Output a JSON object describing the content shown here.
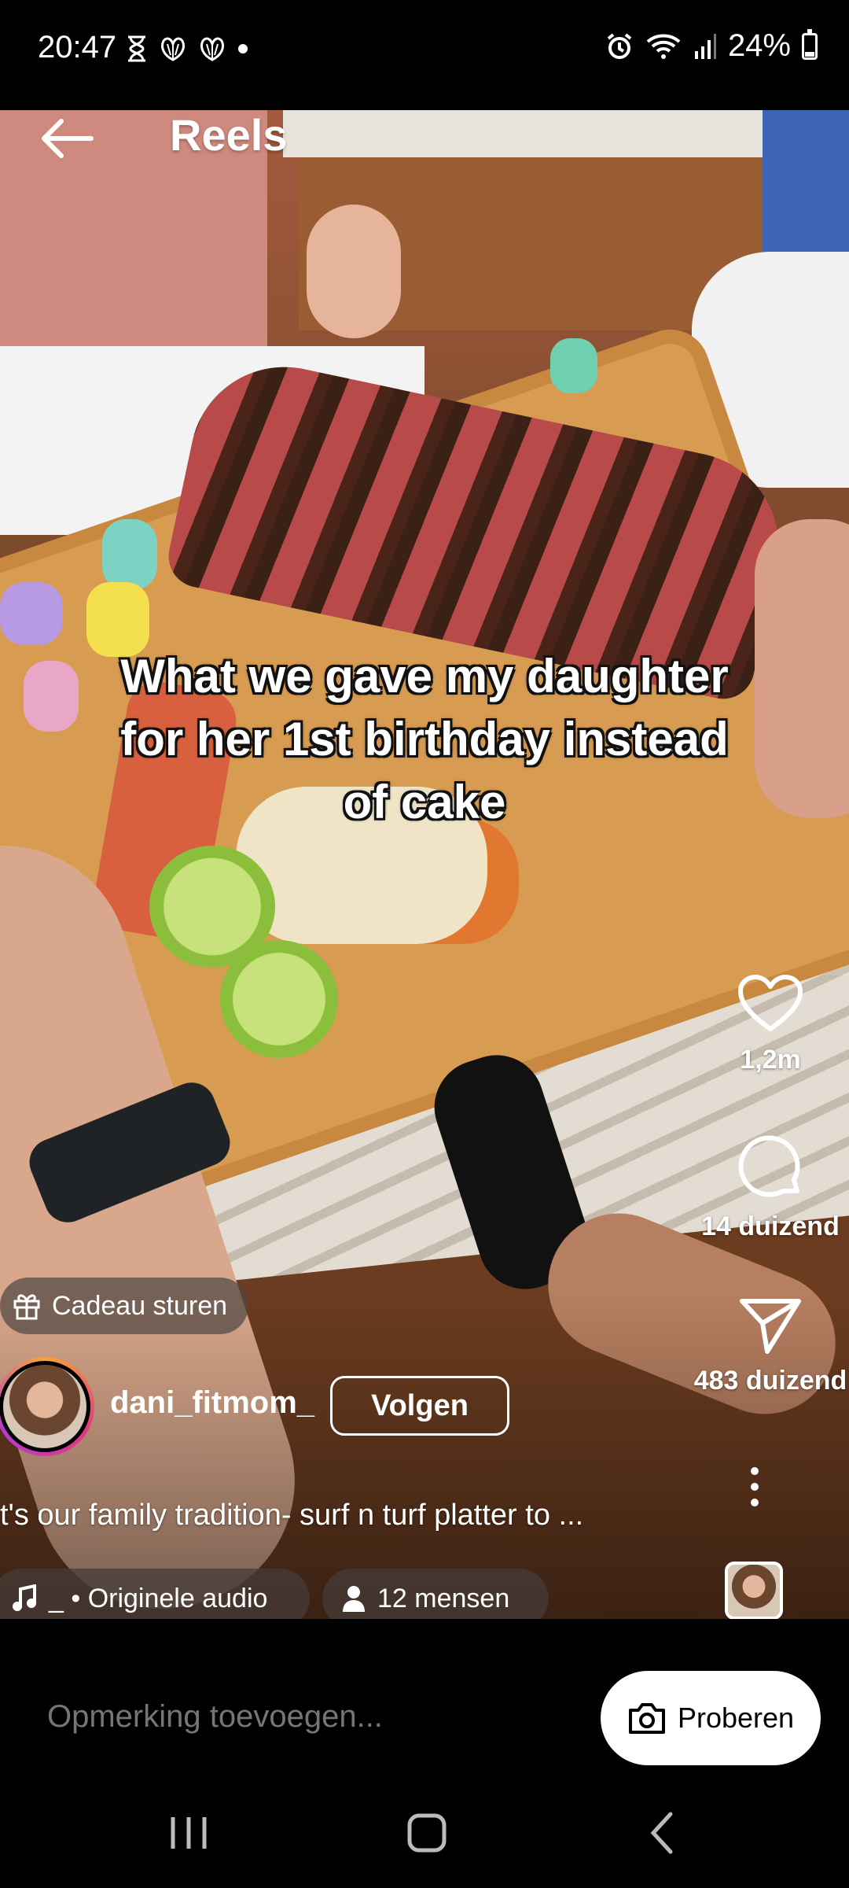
{
  "status_bar": {
    "time": "20:47",
    "battery": "24%",
    "icons_left": [
      "hourglass-icon",
      "shell-icon",
      "shell-icon",
      "dot-icon"
    ],
    "icons_right": [
      "alarm-icon",
      "wifi-icon",
      "signal-icon",
      "battery-icon"
    ]
  },
  "header": {
    "title": "Reels"
  },
  "video": {
    "overlay_text": "What we gave my daughter for her 1st birthday instead of cake"
  },
  "actions": {
    "likes": "1,2m",
    "comments": "14 duizend",
    "shares": "483 duizend"
  },
  "gift": {
    "label": "Cadeau sturen"
  },
  "author": {
    "username": "dani_fitmom_",
    "follow_label": "Volgen"
  },
  "caption": "t's our family tradition- surf n turf platter to ...",
  "audio": {
    "label": "_ • Originele audio",
    "people_label": "12 mensen"
  },
  "comment": {
    "placeholder": "Opmerking toevoegen...",
    "try_label": "Proberen"
  },
  "colors": {
    "background": "#000000",
    "chip": "#463c38",
    "avatar_ring": [
      "#f9a33a",
      "#e03a7b",
      "#b73ad3"
    ]
  }
}
